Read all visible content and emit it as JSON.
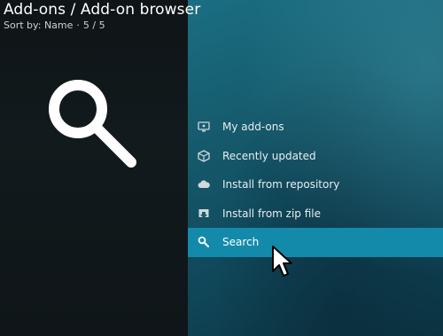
{
  "header": {
    "title": "Add-ons / Add-on browser",
    "sort_label": "Sort by: Name",
    "separator": "·",
    "count": "5 / 5"
  },
  "menu": {
    "items": [
      {
        "label": "My add-ons",
        "icon": "monitor-icon"
      },
      {
        "label": "Recently updated",
        "icon": "box-icon"
      },
      {
        "label": "Install from repository",
        "icon": "cloud-icon"
      },
      {
        "label": "Install from zip file",
        "icon": "download-box-icon"
      },
      {
        "label": "Search",
        "icon": "search-icon",
        "focused": true
      }
    ]
  },
  "colors": {
    "focus": "#138aaa",
    "panel_left": "#0f1416",
    "panel_right": "#155a6c"
  }
}
